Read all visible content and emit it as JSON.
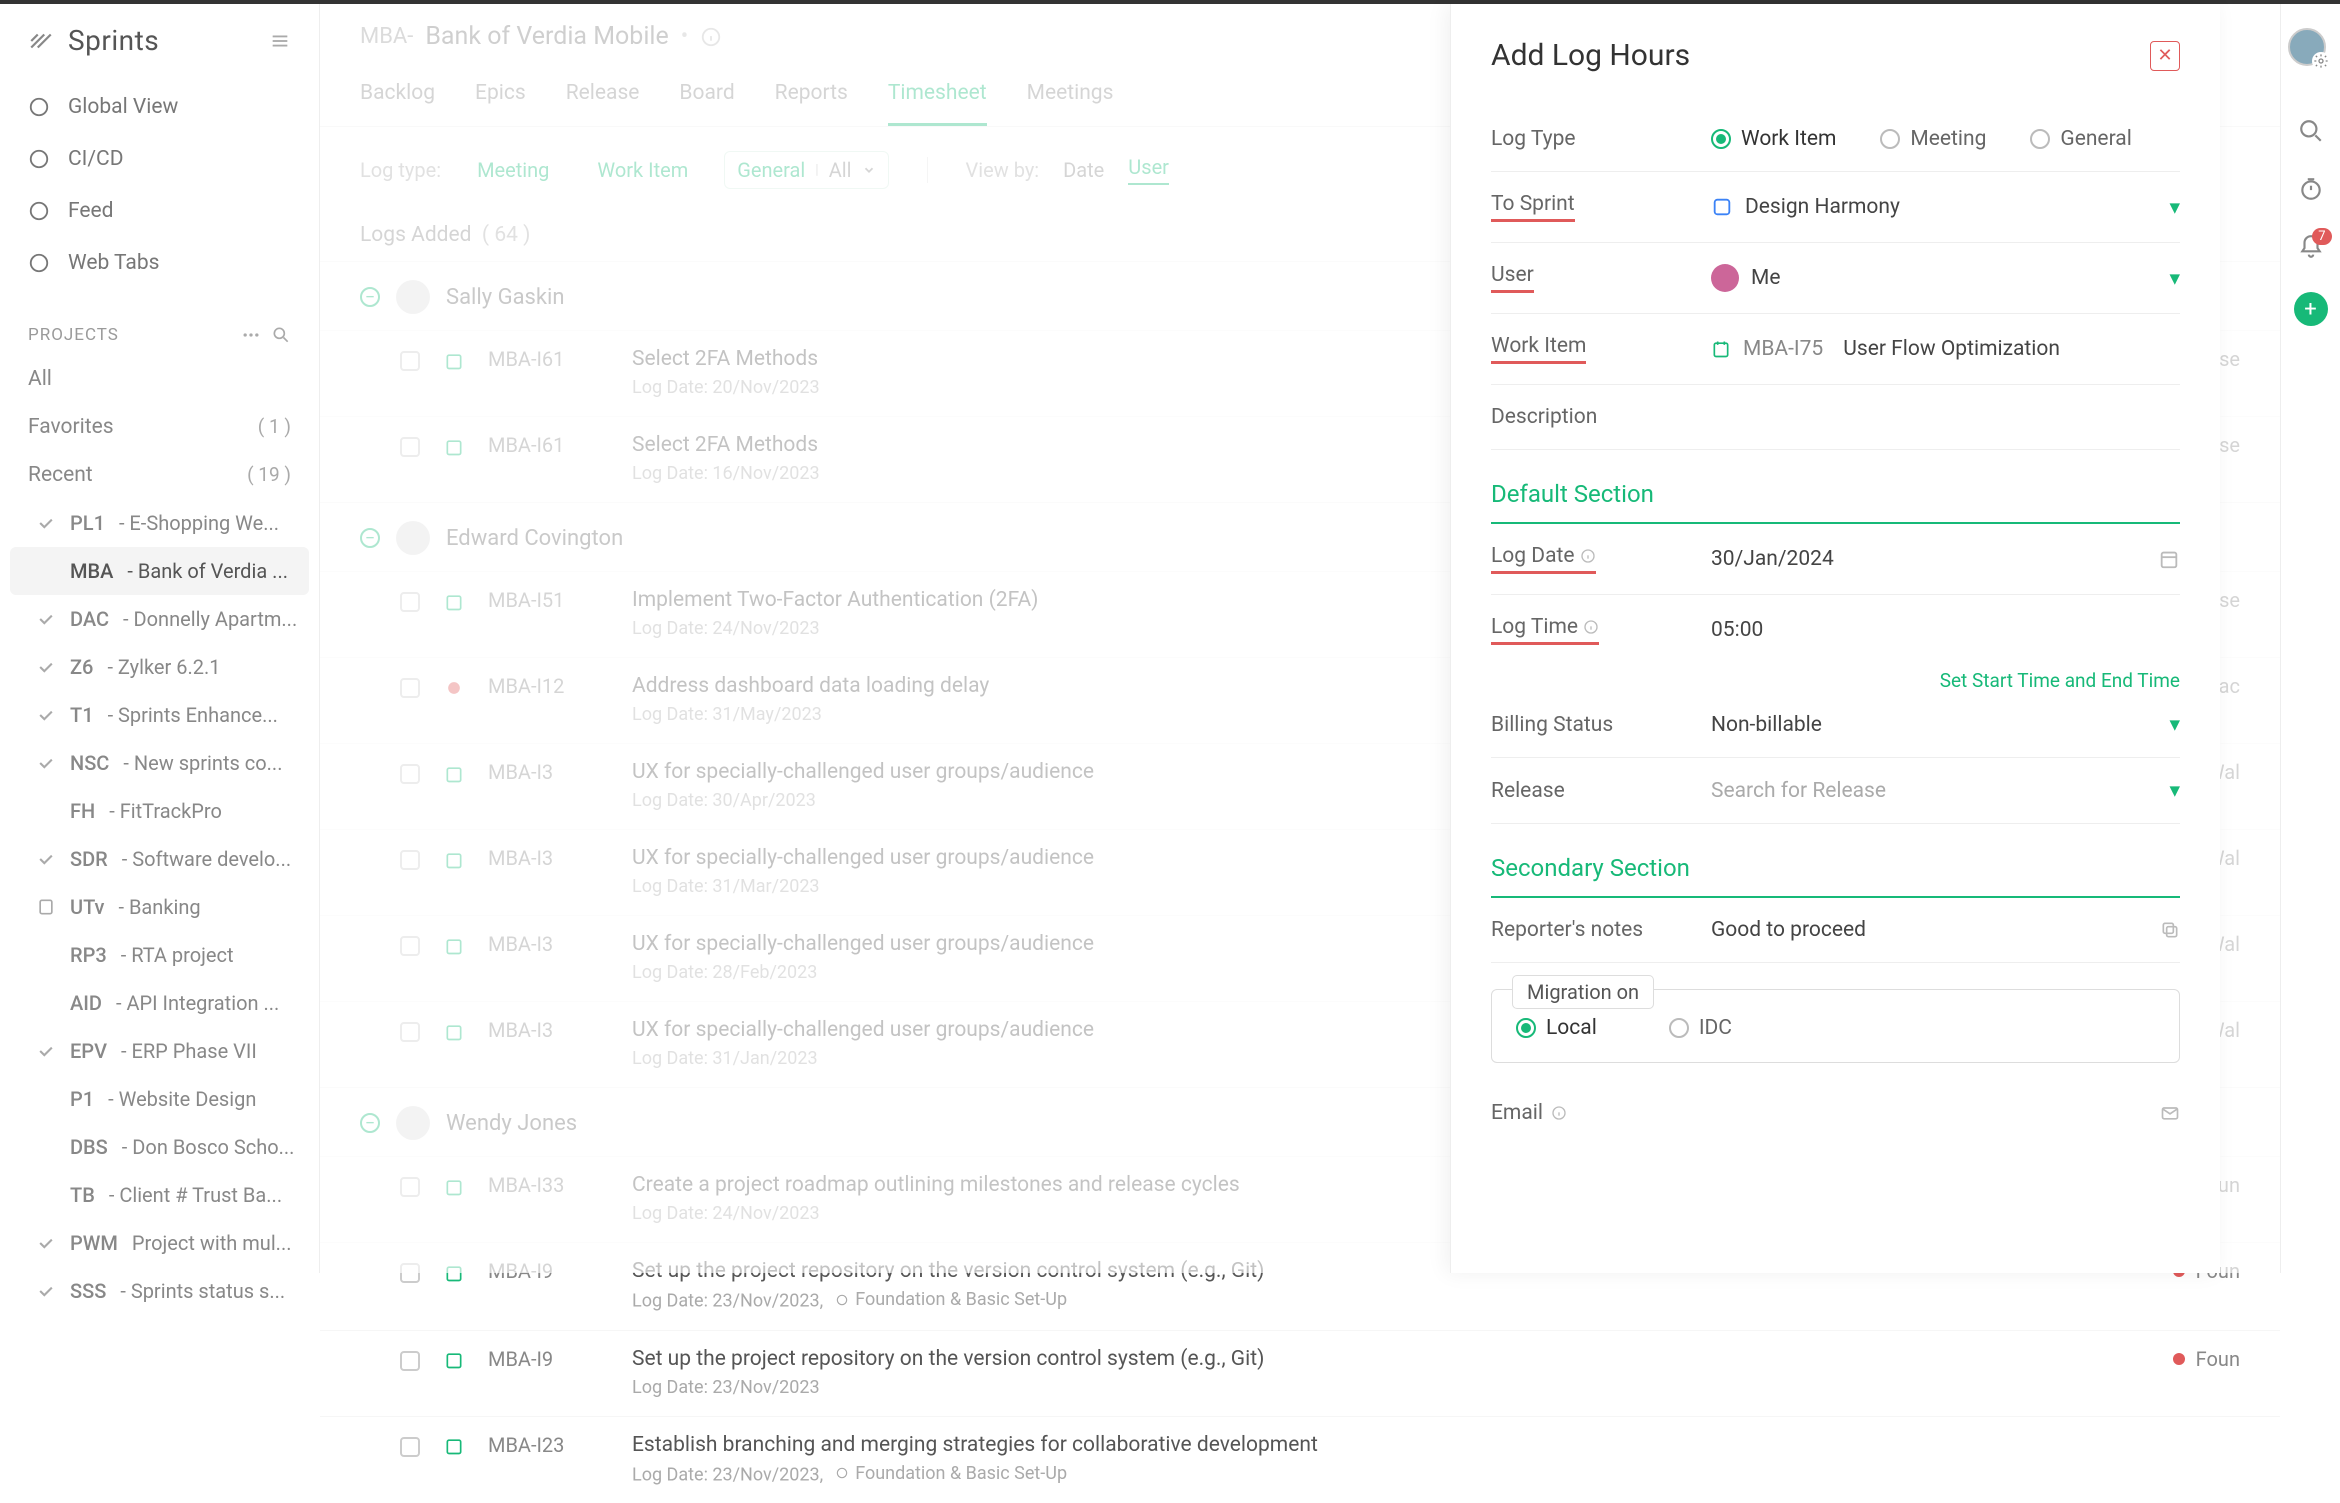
{
  "brand": "Sprints",
  "nav": [
    {
      "icon": "globe",
      "label": "Global View"
    },
    {
      "icon": "cicd",
      "label": "CI/CD"
    },
    {
      "icon": "feed",
      "label": "Feed"
    },
    {
      "icon": "web",
      "label": "Web Tabs"
    }
  ],
  "projects_header": "PROJECTS",
  "proj_groups": [
    {
      "label": "All",
      "count": ""
    },
    {
      "label": "Favorites",
      "count": "( 1 )"
    },
    {
      "label": "Recent",
      "count": "( 19 )"
    }
  ],
  "projects": [
    {
      "icon": "check",
      "code": "PL1",
      "name": "- E-Shopping We..."
    },
    {
      "icon": "blank",
      "code": "MBA",
      "name": "- Bank of Verdia ...",
      "active": true
    },
    {
      "icon": "check",
      "code": "DAC",
      "name": "- Donnelly Apartm..."
    },
    {
      "icon": "check",
      "code": "Z6",
      "name": "- Zylker 6.2.1"
    },
    {
      "icon": "check",
      "code": "T1",
      "name": "- Sprints Enhance..."
    },
    {
      "icon": "check",
      "code": "NSC",
      "name": "- New sprints co..."
    },
    {
      "icon": "blank",
      "code": "FH",
      "name": "- FitTrackPro"
    },
    {
      "icon": "check",
      "code": "SDR",
      "name": "- Software develo..."
    },
    {
      "icon": "doc",
      "code": "UTv",
      "name": "- Banking"
    },
    {
      "icon": "blank",
      "code": "RP3",
      "name": "- RTA project"
    },
    {
      "icon": "blank",
      "code": "AID",
      "name": "- API Integration ..."
    },
    {
      "icon": "check",
      "code": "EPV",
      "name": "- ERP Phase VII"
    },
    {
      "icon": "blank",
      "code": "P1",
      "name": "- Website Design"
    },
    {
      "icon": "blank",
      "code": "DBS",
      "name": "- Don Bosco Scho..."
    },
    {
      "icon": "blank",
      "code": "TB",
      "name": "- Client # Trust Ba..."
    },
    {
      "icon": "check",
      "code": "PWM",
      "name": "Project with mul..."
    },
    {
      "icon": "check",
      "code": "SSS",
      "name": "- Sprints status s..."
    }
  ],
  "breadcrumb": {
    "code": "MBA-",
    "name": "Bank of Verdia Mobile"
  },
  "tabs": [
    "Backlog",
    "Epics",
    "Release",
    "Board",
    "Reports",
    "Timesheet",
    "Meetings"
  ],
  "active_tab": "Timesheet",
  "filter_label": "Log type:",
  "log_types": [
    "Meeting",
    "Work Item",
    "General"
  ],
  "general_extra": "All",
  "viewby_label": "View by:",
  "viewby_opts": [
    "Date",
    "User"
  ],
  "viewby_active": "User",
  "logs_heading": "Logs Added",
  "logs_count": "( 64 )",
  "groups": [
    {
      "user": "Sally Gaskin",
      "rows": [
        {
          "type": "task",
          "id": "MBA-I61",
          "title": "Select 2FA Methods",
          "date": "Log Date: 20/Nov/2023",
          "sprint": "Use",
          "spc": "red"
        },
        {
          "type": "task",
          "id": "MBA-I61",
          "title": "Select 2FA Methods",
          "date": "Log Date: 16/Nov/2023",
          "sprint": "Use",
          "spc": "red"
        }
      ]
    },
    {
      "user": "Edward Covington",
      "rows": [
        {
          "type": "task",
          "id": "MBA-I51",
          "title": "Implement Two-Factor Authentication (2FA)",
          "date": "Log Date: 24/Nov/2023",
          "sprint": "Use",
          "spc": "red"
        },
        {
          "type": "bug",
          "id": "MBA-I12",
          "title": "Address dashboard data loading delay",
          "date": "Log Date: 31/May/2023",
          "sprint": "Bac",
          "spc": "blue"
        },
        {
          "type": "task",
          "id": "MBA-I3",
          "title": "UX for specially-challenged user groups/audience",
          "date": "Log Date: 30/Apr/2023",
          "sprint": "Wal",
          "spc": "red"
        },
        {
          "type": "task",
          "id": "MBA-I3",
          "title": "UX for specially-challenged user groups/audience",
          "date": "Log Date: 31/Mar/2023",
          "sprint": "Wal",
          "spc": "red"
        },
        {
          "type": "task",
          "id": "MBA-I3",
          "title": "UX for specially-challenged user groups/audience",
          "date": "Log Date: 28/Feb/2023",
          "sprint": "Wal",
          "spc": "red"
        },
        {
          "type": "task",
          "id": "MBA-I3",
          "title": "UX for specially-challenged user groups/audience",
          "date": "Log Date: 31/Jan/2023",
          "sprint": "Wal",
          "spc": "red"
        }
      ]
    },
    {
      "user": "Wendy Jones",
      "rows": [
        {
          "type": "task",
          "id": "MBA-I33",
          "title": "Create a project roadmap outlining milestones and release cycles",
          "date": "Log Date: 24/Nov/2023",
          "sprint": "Foun",
          "spc": "red"
        },
        {
          "type": "task",
          "id": "MBA-I9",
          "title": "Set up the project repository on the version control system (e.g., Git)",
          "date": "Log Date: 23/Nov/2023,",
          "sprint": "Foun",
          "spc": "red",
          "tag": "Foundation & Basic Set-Up"
        },
        {
          "type": "task",
          "id": "MBA-I9",
          "title": "Set up the project repository on the version control system (e.g., Git)",
          "date": "Log Date: 23/Nov/2023",
          "sprint": "Foun",
          "spc": "red"
        },
        {
          "type": "task",
          "id": "MBA-I23",
          "title": "Establish branching and merging strategies for collaborative development",
          "date": "Log Date: 23/Nov/2023,",
          "sprint": "",
          "spc": "",
          "tag": "Foundation & Basic Set-Up"
        }
      ]
    }
  ],
  "panel": {
    "title": "Add Log Hours",
    "log_type_label": "Log Type",
    "log_type_opts": [
      "Work Item",
      "Meeting",
      "General"
    ],
    "log_type_val": "Work Item",
    "to_sprint_label": "To Sprint",
    "to_sprint_val": "Design Harmony",
    "user_label": "User",
    "user_val": "Me",
    "work_item_label": "Work Item",
    "work_item_id": "MBA-I75",
    "work_item_val": "User Flow Optimization",
    "desc_label": "Description",
    "section1": "Default Section",
    "log_date_label": "Log Date",
    "log_date_val": "30/Jan/2024",
    "log_time_label": "Log Time",
    "log_time_val": "05:00",
    "set_times": "Set Start Time and End Time",
    "billing_label": "Billing Status",
    "billing_val": "Non-billable",
    "release_label": "Release",
    "release_ph": "Search for Release",
    "section2": "Secondary Section",
    "notes_label": "Reporter's notes",
    "notes_val": "Good to proceed",
    "migration_label": "Migration on",
    "migration_opts": [
      "Local",
      "IDC"
    ],
    "migration_val": "Local",
    "email_label": "Email"
  },
  "rightbar": {
    "badge": "7"
  }
}
